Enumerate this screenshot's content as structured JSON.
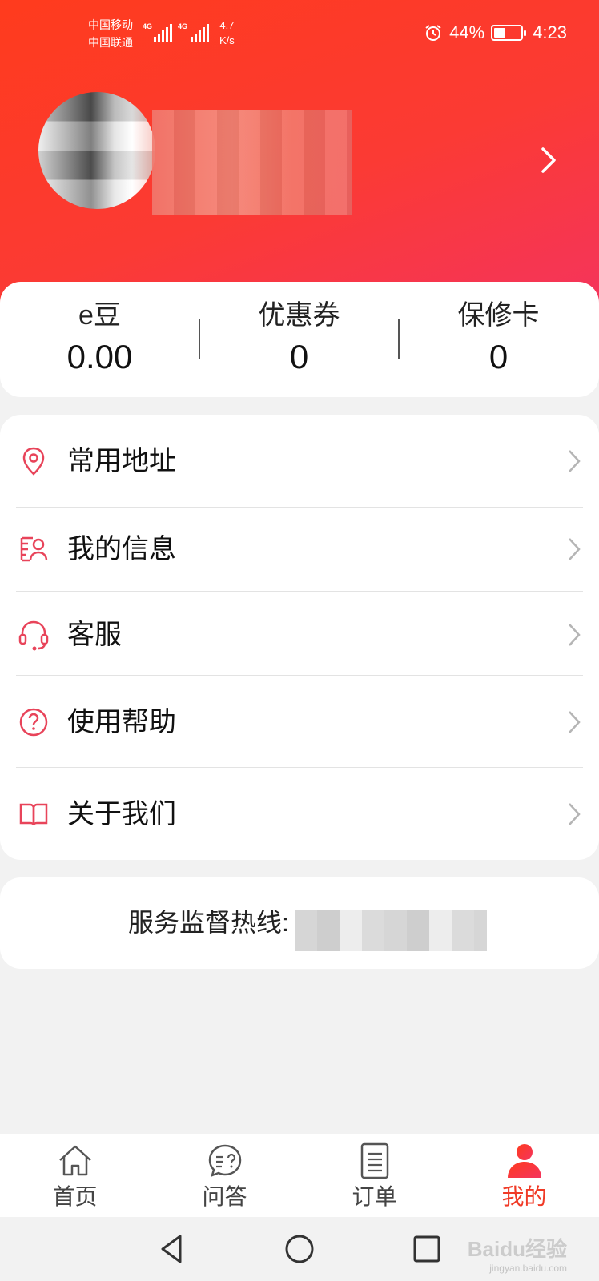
{
  "status_bar": {
    "carrier_1": "中国移动",
    "carrier_2": "中国联通",
    "network_1": "4G",
    "network_2": "4G",
    "speed_value": "4.7",
    "speed_unit": "K/s",
    "battery_percent": "44%",
    "battery_level": 0.44,
    "time": "4:23"
  },
  "stats": [
    {
      "label": "e豆",
      "value": "0.00"
    },
    {
      "label": "优惠券",
      "value": "0"
    },
    {
      "label": "保修卡",
      "value": "0"
    }
  ],
  "menu": [
    {
      "label": "常用地址",
      "icon": "location-pin-icon"
    },
    {
      "label": "我的信息",
      "icon": "user-info-icon"
    },
    {
      "label": "客服",
      "icon": "headset-icon"
    },
    {
      "label": "使用帮助",
      "icon": "help-circle-icon"
    },
    {
      "label": "关于我们",
      "icon": "open-book-icon"
    }
  ],
  "hotline": {
    "label": "服务监督热线:"
  },
  "tabs": [
    {
      "label": "首页",
      "icon": "home-icon"
    },
    {
      "label": "问答",
      "icon": "qa-bubble-icon"
    },
    {
      "label": "订单",
      "icon": "order-list-icon"
    },
    {
      "label": "我的",
      "icon": "profile-icon",
      "active": true
    }
  ],
  "watermark": {
    "text": "Baidu经验",
    "sub": "jingyan.baidu.com"
  },
  "colors": {
    "brand_red": "#ff3b1d",
    "accent_pink": "#f4345e",
    "active_tab": "#f03a26",
    "icon_red": "#e8445a"
  }
}
